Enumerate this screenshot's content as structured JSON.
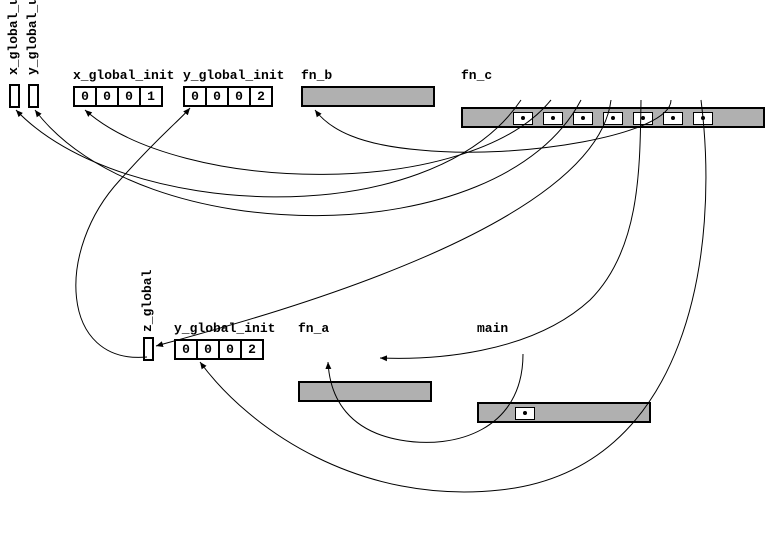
{
  "top_row": {
    "x_global_uninit": {
      "label": "x_global_unin"
    },
    "y_global_uninit": {
      "label": "y_global_unin"
    },
    "x_global_init": {
      "label": "x_global_init",
      "bytes": [
        "0",
        "0",
        "0",
        "1"
      ]
    },
    "y_global_init": {
      "label": "y_global_init",
      "bytes": [
        "0",
        "0",
        "0",
        "2"
      ]
    },
    "fn_b": {
      "label": "fn_b"
    },
    "fn_c": {
      "label": "fn_c"
    }
  },
  "bottom_row": {
    "z_global": {
      "label": "z_global"
    },
    "y_global_init": {
      "label": "y_global_init",
      "bytes": [
        "0",
        "0",
        "0",
        "2"
      ]
    },
    "fn_a": {
      "label": "fn_a"
    },
    "main": {
      "label": "main"
    }
  },
  "fn_c_slots": 7,
  "main_slots": 1,
  "arrows": [
    {
      "from": "main.slot0",
      "to": "fn_a"
    },
    {
      "from": "fn_c.slot0",
      "to": "x_global_uninit"
    },
    {
      "from": "fn_c.slot1",
      "to": "x_global_init"
    },
    {
      "from": "fn_c.slot2",
      "to": "y_global_uninit"
    },
    {
      "from": "fn_c.slot3",
      "to": "z_global"
    },
    {
      "from": "fn_c.slot4",
      "to": "fn_a"
    },
    {
      "from": "fn_c.slot5",
      "to": "fn_b"
    },
    {
      "from": "fn_c.slot6",
      "to": "y_global_init_bottom"
    },
    {
      "from": "z_global",
      "to": "y_global_init_top"
    }
  ]
}
